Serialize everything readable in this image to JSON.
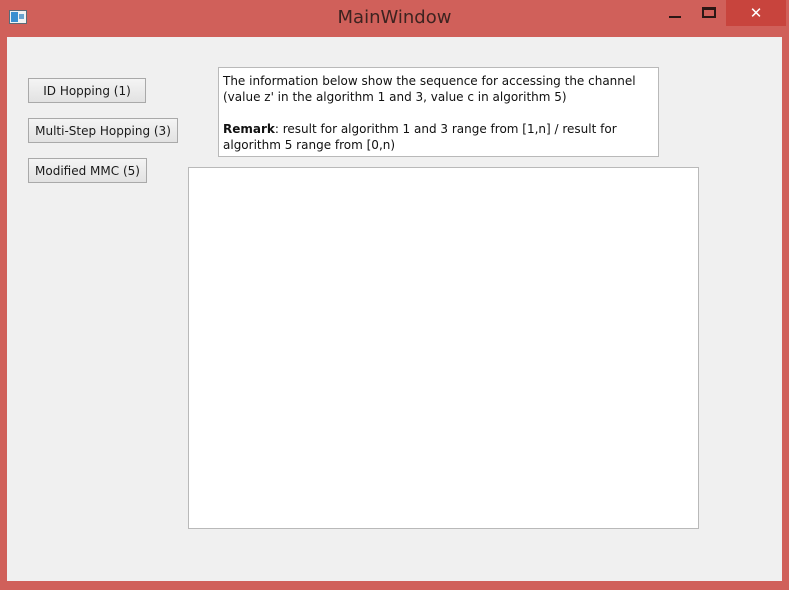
{
  "window": {
    "title": "MainWindow",
    "minimize_icon": "minimize-icon",
    "maximize_icon": "maximize-icon",
    "close_glyph": "✕"
  },
  "buttons": {
    "id_hopping": "ID Hopping (1)",
    "multi_step": "Multi-Step Hopping (3)",
    "modified_mmc": "Modified MMC (5)"
  },
  "info": {
    "line1": "The information below show the sequence for accessing the channel",
    "line2": "(value z' in the algorithm 1 and 3, value c in algorithm 5)",
    "remark_label": "Remark",
    "remark_text1": ": result for algorithm 1 and 3 range from [1,n] / result for",
    "remark_text2": "algorithm 5 range from [0,n)"
  },
  "output": {
    "value": ""
  },
  "colors": {
    "titlebar": "#d0605a",
    "close_button": "#c8443d",
    "client_bg": "#f0f0f0"
  }
}
